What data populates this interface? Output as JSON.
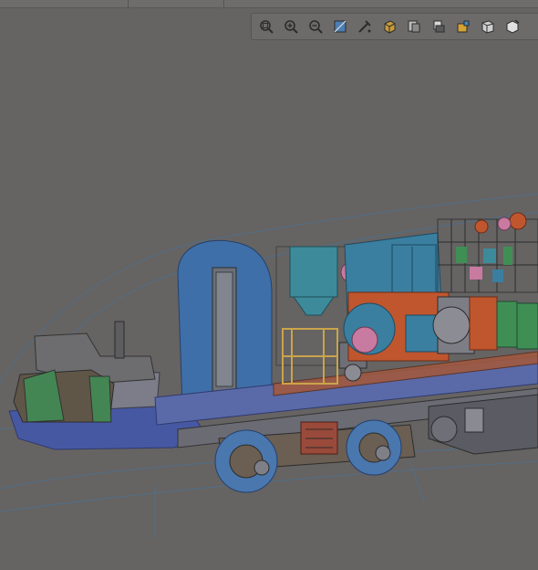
{
  "window": {
    "background": "#666363"
  },
  "toolbar": {
    "buttons": [
      {
        "name": "zoom-fit-icon"
      },
      {
        "name": "zoom-in-icon"
      },
      {
        "name": "zoom-out-icon"
      },
      {
        "name": "zoom-area-icon"
      },
      {
        "name": "pan-icon"
      },
      {
        "name": "rotate-view-icon"
      },
      {
        "name": "section-view-icon"
      },
      {
        "name": "display-style-icon"
      },
      {
        "name": "hide-show-icon"
      },
      {
        "name": "edit-appearance-icon"
      },
      {
        "name": "view-orientation-icon"
      }
    ]
  },
  "model": {
    "subject": "locomotive-assembly-3d-model",
    "colors": {
      "cab_blue": "#3f6fa8",
      "frame_blue": "#4a5fb0",
      "teal": "#3d8a9a",
      "orange": "#c0562e",
      "green": "#3f8f55",
      "pink": "#c87aa0",
      "gold": "#c9a44a"
    }
  }
}
